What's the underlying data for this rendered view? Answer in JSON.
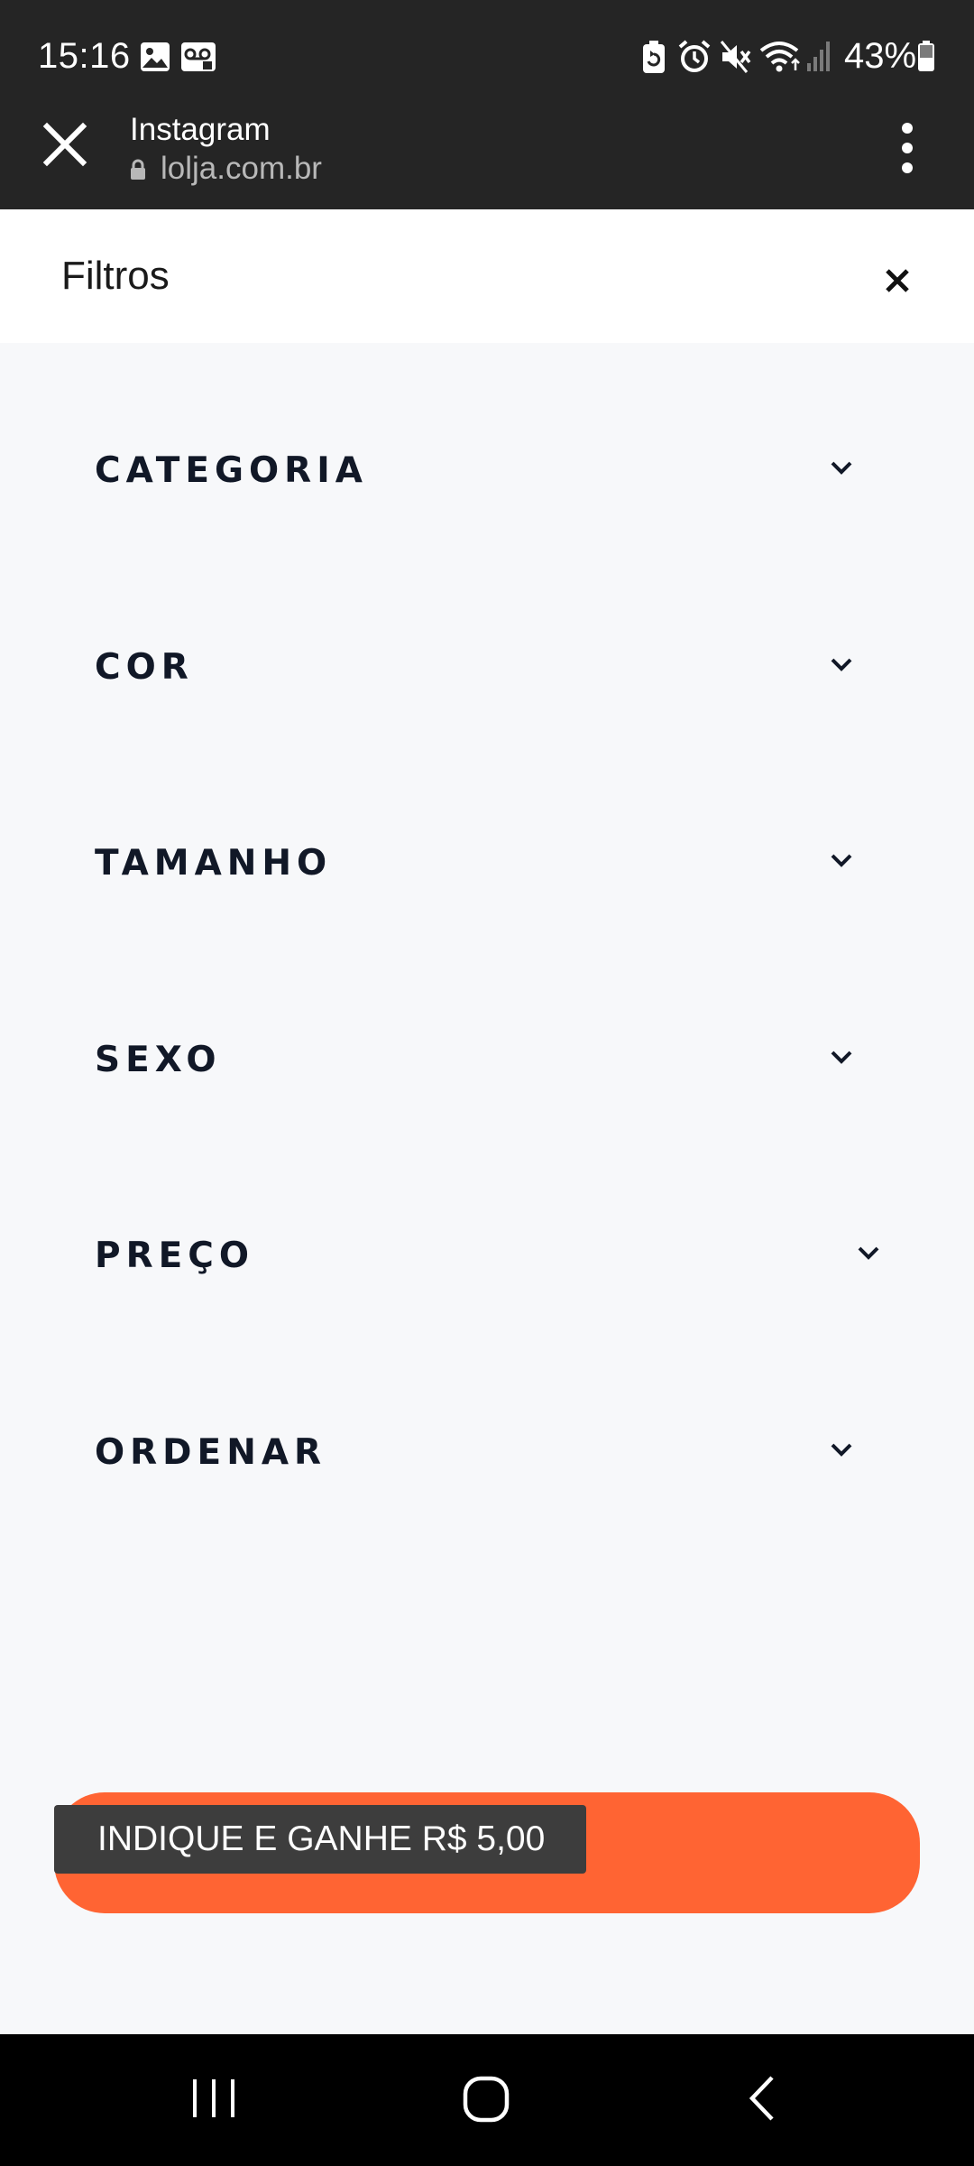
{
  "status_bar": {
    "time": "15:16",
    "battery_text": "43%",
    "icons": [
      "gallery-icon",
      "voicemail-icon",
      "battery-saver-icon",
      "alarm-icon",
      "mute-icon",
      "wifi-icon",
      "signal-icon",
      "battery-icon"
    ]
  },
  "browser": {
    "title": "Instagram",
    "url": "lolja.com.br",
    "icons": [
      "close-icon",
      "lock-icon",
      "more-vert-icon"
    ]
  },
  "filters": {
    "title": "Filtros",
    "close_icon": "close-icon",
    "items": [
      {
        "label": "CATEGORIA"
      },
      {
        "label": "COR"
      },
      {
        "label": "TAMANHO"
      },
      {
        "label": "SEXO"
      },
      {
        "label": "PREÇO"
      },
      {
        "label": "ORDENAR"
      }
    ]
  },
  "referral": {
    "label": "INDIQUE E GANHE R$ 5,00",
    "accent_color": "#ff6433",
    "tooltip_color": "#3d3d3d"
  },
  "nav_bar": {
    "icons": [
      "recent-apps-icon",
      "home-icon",
      "back-icon"
    ]
  }
}
